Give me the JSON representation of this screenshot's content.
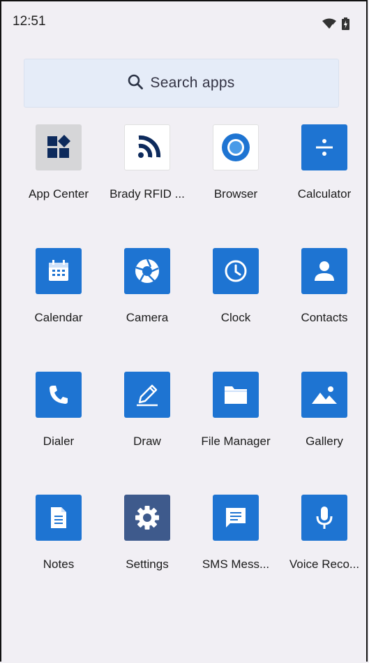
{
  "status_bar": {
    "time": "12:51",
    "wifi_icon": "wifi-icon",
    "battery_icon": "battery-charging-icon"
  },
  "search": {
    "label": "Search apps",
    "icon": "search-icon"
  },
  "apps": [
    {
      "label": "App Center",
      "icon": "app-center-icon"
    },
    {
      "label": "Brady RFID ...",
      "icon": "brady-rfid-icon"
    },
    {
      "label": "Browser",
      "icon": "browser-icon"
    },
    {
      "label": "Calculator",
      "icon": "calculator-icon"
    },
    {
      "label": "Calendar",
      "icon": "calendar-icon"
    },
    {
      "label": "Camera",
      "icon": "camera-icon"
    },
    {
      "label": "Clock",
      "icon": "clock-icon"
    },
    {
      "label": "Contacts",
      "icon": "contacts-icon"
    },
    {
      "label": "Dialer",
      "icon": "dialer-icon"
    },
    {
      "label": "Draw",
      "icon": "draw-icon"
    },
    {
      "label": "File Manager",
      "icon": "file-manager-icon"
    },
    {
      "label": "Gallery",
      "icon": "gallery-icon"
    },
    {
      "label": "Notes",
      "icon": "notes-icon"
    },
    {
      "label": "Settings",
      "icon": "settings-icon"
    },
    {
      "label": "SMS Mess...",
      "icon": "sms-icon"
    },
    {
      "label": "Voice Reco...",
      "icon": "microphone-icon"
    }
  ],
  "colors": {
    "tile_blue": "#1e74d2",
    "background": "#f1eff4",
    "search_bg": "#e5ecf8"
  }
}
